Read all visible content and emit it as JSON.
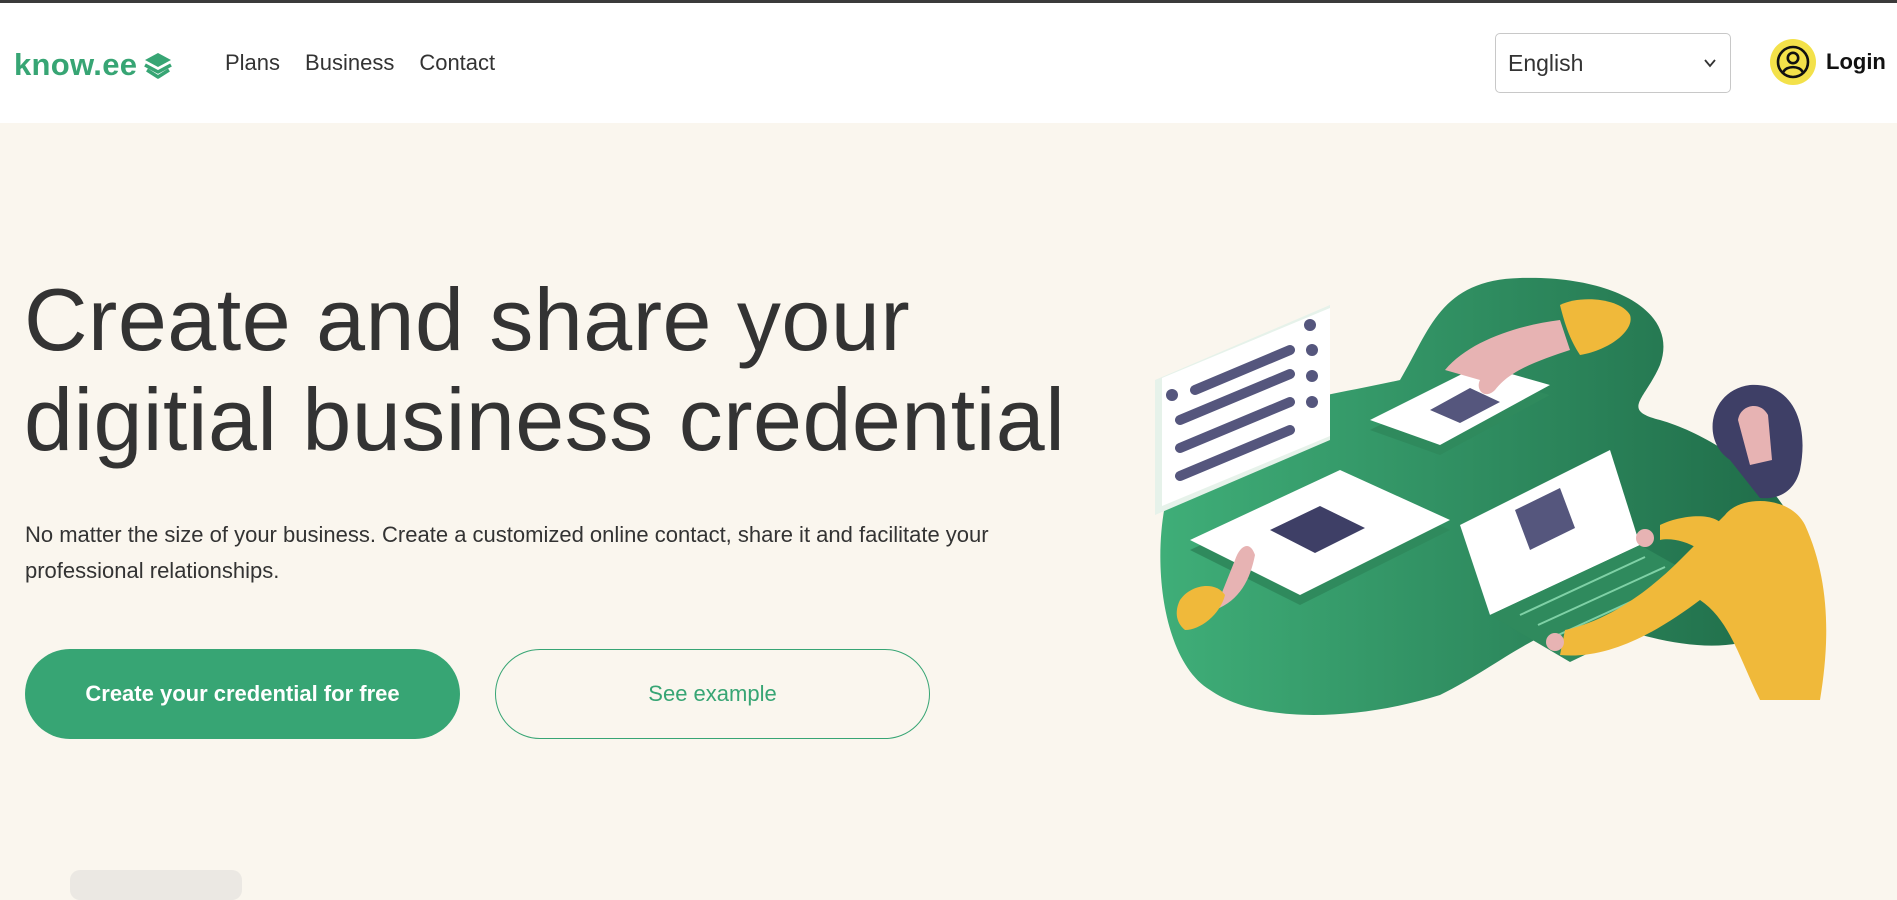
{
  "brand": {
    "name": "know.ee",
    "logo_icon": "layers-icon",
    "color": "#37a574"
  },
  "nav": {
    "links": [
      "Plans",
      "Business",
      "Contact"
    ]
  },
  "language": {
    "selected": "English",
    "icon": "chevron-down-icon"
  },
  "login": {
    "label": "Login",
    "icon": "user-circle-icon",
    "icon_bg": "#f3e14a"
  },
  "hero": {
    "title_line1": "Create and share your",
    "title_line2": "digitial business credential",
    "subtitle": "No matter the size of your business. Create a customized online contact, share it and facilitate your professional relationships.",
    "primary_cta": "Create your credential for free",
    "secondary_cta": "See example"
  },
  "colors": {
    "background": "#faf6ee",
    "accent": "#37a574",
    "text": "#333333",
    "yellow": "#f0b93a"
  }
}
